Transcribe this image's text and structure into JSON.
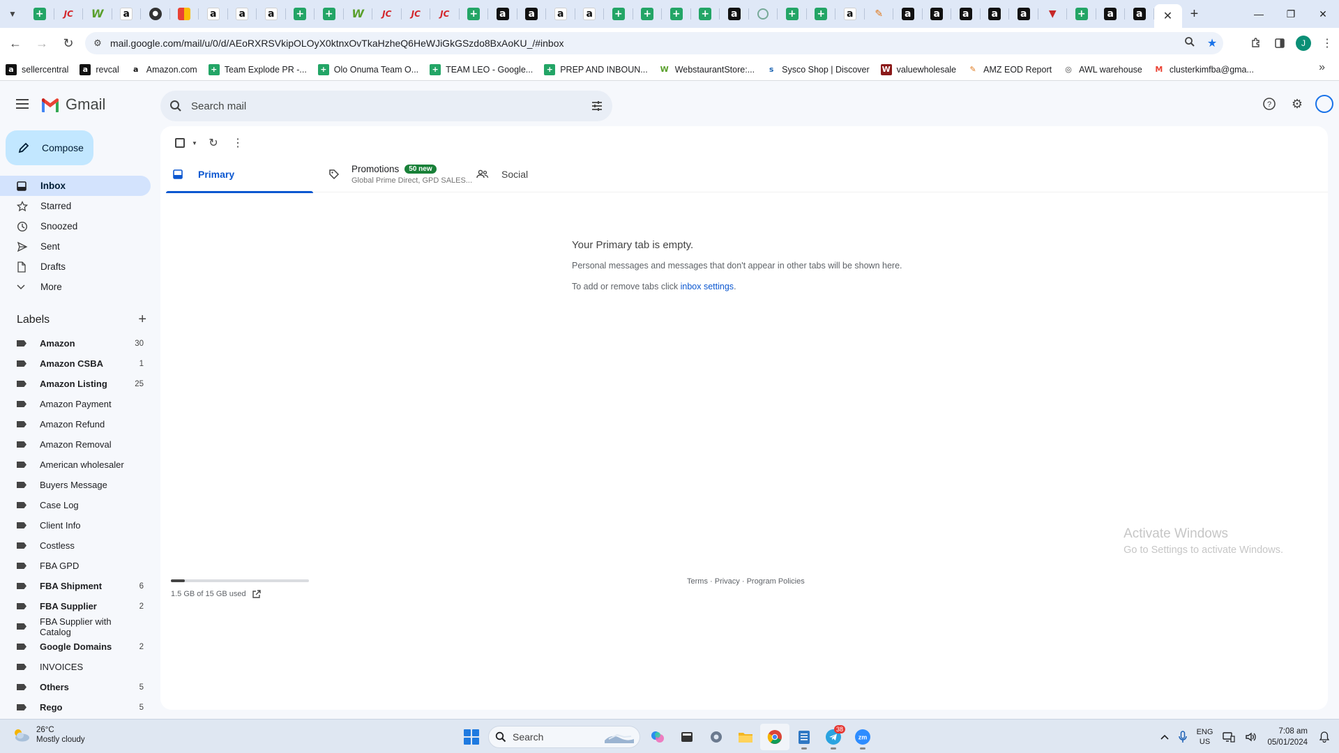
{
  "browser": {
    "tab_favicons": [
      "sheets",
      "jc",
      "w",
      "amazon",
      "circle",
      "multi",
      "amazon",
      "amazon",
      "amazon",
      "sheets",
      "sheets",
      "w",
      "jc",
      "jc",
      "jc",
      "sheets",
      "amazon-dark",
      "amazon-dark",
      "amazon",
      "amazon",
      "sheets",
      "sheets",
      "sheets",
      "sheets",
      "amazon-dark",
      "green-circle",
      "sheets",
      "sheets",
      "amazon",
      "pen",
      "amazon-dark",
      "amazon-dark",
      "amazon-dark",
      "amazon-dark",
      "amazon-dark",
      "red-triangle",
      "sheets",
      "amazon-dark",
      "amazon-dark"
    ],
    "url": "mail.google.com/mail/u/0/d/AEoRXRSVkipOLOyX0ktnxOvTkaHzheQ6HeWJiGkGSzdo8BxAoKU_/#inbox",
    "profile_initial": "J",
    "bookmarks": [
      {
        "label": "sellercentral",
        "icon": "amazon-dark"
      },
      {
        "label": "revcal",
        "icon": "amazon-dark"
      },
      {
        "label": "Amazon.com",
        "icon": "amazon"
      },
      {
        "label": "Team Explode PR -...",
        "icon": "sheets"
      },
      {
        "label": "Olo Onuma Team O...",
        "icon": "sheets"
      },
      {
        "label": "TEAM LEO - Google...",
        "icon": "sheets"
      },
      {
        "label": "PREP AND INBOUN...",
        "icon": "sheets"
      },
      {
        "label": "WebstaurantStore:...",
        "icon": "w"
      },
      {
        "label": "Sysco Shop | Discover",
        "icon": "sysco"
      },
      {
        "label": "valuewholesale",
        "icon": "vw"
      },
      {
        "label": "AMZ EOD Report",
        "icon": "pen"
      },
      {
        "label": "AWL warehouse",
        "icon": "globe"
      },
      {
        "label": "clusterkimfba@gma...",
        "icon": "gmail"
      }
    ]
  },
  "gmail": {
    "wordmark": "Gmail",
    "search_placeholder": "Search mail",
    "compose_label": "Compose",
    "nav": [
      {
        "label": "Inbox",
        "icon": "inbox-icon",
        "active": true
      },
      {
        "label": "Starred",
        "icon": "star-icon",
        "active": false
      },
      {
        "label": "Snoozed",
        "icon": "clock-icon",
        "active": false
      },
      {
        "label": "Sent",
        "icon": "send-icon",
        "active": false
      },
      {
        "label": "Drafts",
        "icon": "draft-icon",
        "active": false
      },
      {
        "label": "More",
        "icon": "chevron-down-icon",
        "active": false
      }
    ],
    "labels_title": "Labels",
    "labels": [
      {
        "name": "Amazon",
        "count": "30",
        "bold": true
      },
      {
        "name": "Amazon CSBA",
        "count": "1",
        "bold": true
      },
      {
        "name": "Amazon Listing",
        "count": "25",
        "bold": true
      },
      {
        "name": "Amazon Payment",
        "count": "",
        "bold": false
      },
      {
        "name": "Amazon Refund",
        "count": "",
        "bold": false
      },
      {
        "name": "Amazon Removal",
        "count": "",
        "bold": false
      },
      {
        "name": "American wholesaler",
        "count": "",
        "bold": false
      },
      {
        "name": "Buyers Message",
        "count": "",
        "bold": false
      },
      {
        "name": "Case Log",
        "count": "",
        "bold": false
      },
      {
        "name": "Client Info",
        "count": "",
        "bold": false
      },
      {
        "name": "Costless",
        "count": "",
        "bold": false
      },
      {
        "name": "FBA GPD",
        "count": "",
        "bold": false
      },
      {
        "name": "FBA Shipment",
        "count": "6",
        "bold": true
      },
      {
        "name": "FBA Supplier",
        "count": "2",
        "bold": true
      },
      {
        "name": "FBA Supplier with Catalog",
        "count": "",
        "bold": false
      },
      {
        "name": "Google Domains",
        "count": "2",
        "bold": true
      },
      {
        "name": "INVOICES",
        "count": "",
        "bold": false
      },
      {
        "name": "Others",
        "count": "5",
        "bold": true
      },
      {
        "name": "Rego",
        "count": "5",
        "bold": true
      }
    ],
    "tabs": {
      "primary": "Primary",
      "promotions": "Promotions",
      "promotions_badge": "50 new",
      "promotions_senders": "Global Prime Direct, GPD SALES...",
      "social": "Social"
    },
    "empty_state": {
      "title": "Your Primary tab is empty.",
      "description": "Personal messages and messages that don't appear in other tabs will be shown here.",
      "settings_prefix": "To add or remove tabs click ",
      "settings_link": "inbox settings",
      "settings_suffix": "."
    },
    "storage": {
      "used_text": "1.5 GB of 15 GB used",
      "fraction_used": 0.1
    },
    "footer": {
      "terms": "Terms",
      "separator": " · ",
      "privacy": "Privacy",
      "program_policies": "Program Policies"
    }
  },
  "watermark": {
    "title": "Activate Windows",
    "subtitle": "Go to Settings to activate Windows."
  },
  "taskbar": {
    "temperature": "26°C",
    "weather": "Mostly cloudy",
    "search_label": "Search",
    "telegram_badge": "38",
    "lang_primary": "ENG",
    "lang_secondary": "US",
    "time": "7:08 am",
    "date": "05/01/2024"
  }
}
